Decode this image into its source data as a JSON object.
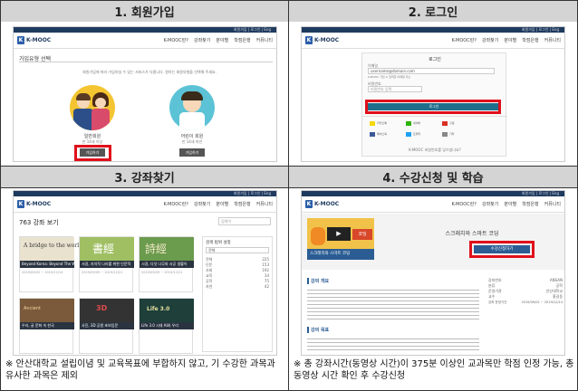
{
  "steps": [
    {
      "title": "1. 회원가입"
    },
    {
      "title": "2. 로그인"
    },
    {
      "title": "3. 강좌찾기"
    },
    {
      "title": "4. 수강신청 및 학습"
    }
  ],
  "site": {
    "logo_text": "K-MOOC",
    "topbar_text": "회원가입 | 로그인 | Eng",
    "menu": [
      "K-MOOC란?",
      "강좌찾기",
      "분야별",
      "학점은행",
      "커뮤니티"
    ]
  },
  "signup": {
    "heading": "가입유형 선택",
    "desc": "회원가입에 따라 가입하실 수 있는 서비스가 다릅니다. 원하는 회원유형을 선택해 주세요.",
    "adult_label": "일반회원",
    "adult_sub": "만 14세 이상",
    "child_label": "어린이 회원",
    "child_sub": "만 14세 미만",
    "join_button": "가입하기"
  },
  "login": {
    "heading": "로그인",
    "email_label": "이메일",
    "email_value": "username@domain.com",
    "email_hint": "K-MOOC 가입 시 입력한 이메일 주소",
    "password_label": "비밀번호",
    "password_placeholder": "비밀번호 입력",
    "login_button": "로그인",
    "social": [
      "카카오톡",
      "네이버",
      "구글",
      "페이스북",
      "트위터",
      "기타"
    ],
    "forgot": "K-MOOC 비밀번호를 잊으셨나요?"
  },
  "search": {
    "count_title": "763 강좌 보기",
    "search_placeholder": "검색어",
    "filter_heading": "검색 범위 설정",
    "filter_select": "전체",
    "filter_rows": [
      {
        "label": "전체",
        "count": "225"
      },
      {
        "label": "인문",
        "count": "153"
      },
      {
        "label": "사회",
        "count": "192"
      },
      {
        "label": "교육",
        "count": "34"
      },
      {
        "label": "공학",
        "count": "75"
      },
      {
        "label": "자연",
        "count": "42"
      }
    ],
    "courses": [
      {
        "title": "A bridge to the world",
        "caption": "Beyond Korea: Beyond The World",
        "meta": "2019/09/02 ~ 2019/12/14"
      },
      {
        "title": "書經",
        "caption": "서경, 자치적 나라를 위한 인문적",
        "meta": "2019/09/09 ~ 2019/12/21"
      },
      {
        "title": "詩經",
        "caption": "시경, 다섯 나무와 사공 생활이",
        "meta": "2019/09/09 ~ 2019/12/21"
      },
      {
        "title": "Ancient",
        "caption": "우리, 글 문화 속 한국",
        "meta": ""
      },
      {
        "title": "3D",
        "caption": "사진, 3D 공원 초보입문",
        "meta": ""
      },
      {
        "title": "Life 3.0",
        "caption": "Life 3.0 시대 AI와 우리",
        "meta": ""
      }
    ]
  },
  "enroll": {
    "course_name": "스크래치와 스마트 코딩",
    "banner_text": "스크래치와 스마트 코딩",
    "enroll_button": "수강신청하기",
    "overview_heading": "강의 개요",
    "goal_heading": "강의 목표",
    "info": [
      {
        "k": "강좌번호",
        "v": "ANSAN"
      },
      {
        "k": "분류",
        "v": "공학"
      },
      {
        "k": "운영기관",
        "v": "안산대학교"
      },
      {
        "k": "교수",
        "v": "홍길동"
      },
      {
        "k": "강좌 운영기간",
        "v": "2019/09/02 ~ 2019/12/14"
      }
    ]
  },
  "footnotes": {
    "left": "※ 안산대학교 설립이념 및 교육목표에 부합하지 않고, 기 수강한 과목과 유사한 과목은 제외",
    "right": "※ 총 강좌시간(동영상 시간)이 375분 이상인 교과목만 학점 인정 가능, 총 동영상 시간 확인 후 수강신청"
  },
  "colors": {
    "highlight": "#e0101a",
    "header_bg": "#d4d4d4",
    "brand": "#1f3a5f",
    "enroll_button": "#2b5d94"
  }
}
